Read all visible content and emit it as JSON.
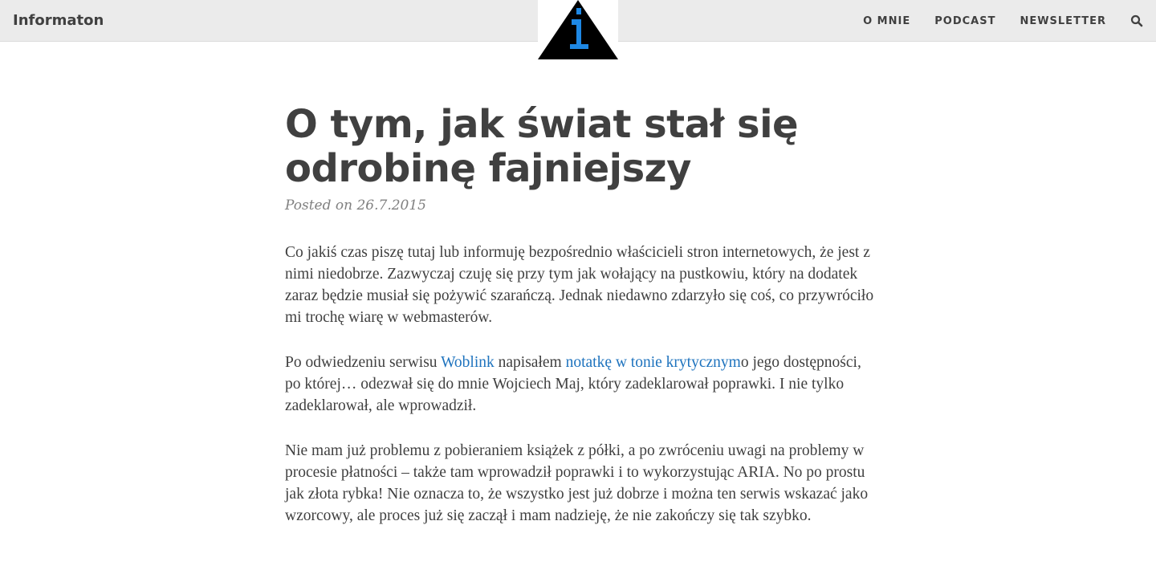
{
  "header": {
    "site_title": "Informaton",
    "nav": [
      {
        "label": "O MNIE"
      },
      {
        "label": "PODCAST"
      },
      {
        "label": "NEWSLETTER"
      }
    ],
    "search_icon": "search-icon",
    "logo_icon": "info-triangle-logo",
    "background": "#ebebeb",
    "logo_accent": "#1e88e5"
  },
  "post": {
    "title": "O tym, jak świat stał się odrobinę fajniejszy",
    "meta": "Posted on 26.7.2015",
    "paragraphs": [
      {
        "text": "Co jakiś czas piszę tutaj lub informuję bezpośrednio właścicieli stron internetowych, że jest z nimi niedobrze. Zazwyczaj czuję się przy tym jak wołający na pustkowiu, który na dodatek zaraz będzie musiał się pożywić szarańczą. Jednak niedawno zdarzyło się coś, co przywróciło mi trochę wiarę w webmasterów."
      },
      {
        "before": "Po odwiedzeniu serwisu ",
        "link1": "Woblink",
        "middle": " napisałem ",
        "link2": "notatkę w tonie krytycznym",
        "after": "o jego dostępności, po której… odezwał się do mnie Wojciech Maj, który zadeklarował poprawki. I nie tylko zadeklarował, ale wprowadził."
      },
      {
        "text": "Nie mam już problemu z pobieraniem książek z półki, a po zwróceniu uwagi na problemy w procesie płatności – także tam wprowadził poprawki i to wykorzystując ARIA. No po prostu jak złota rybka! Nie oznacza to, że wszystko jest już dobrze i można ten serwis wskazać jako wzorcowy, ale proces już się zaczął i mam nadzieję, że nie zakończy się tak szybko."
      }
    ],
    "link_color": "#1e73be"
  }
}
